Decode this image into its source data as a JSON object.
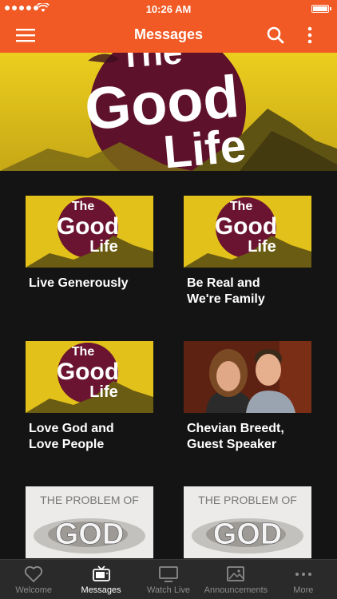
{
  "status_bar": {
    "time": "10:26 AM"
  },
  "header": {
    "title": "Messages"
  },
  "hero": {
    "title_words": [
      "The",
      "Good",
      "Life"
    ]
  },
  "cards": [
    {
      "label": "Live Generously",
      "thumb": "good-life"
    },
    {
      "label": "Be Real and\nWe're Family",
      "thumb": "good-life"
    },
    {
      "label": "Love God and\nLove People",
      "thumb": "good-life"
    },
    {
      "label": "Chevian Breedt,\nGuest Speaker",
      "thumb": "photo"
    },
    {
      "label": "",
      "thumb": "problem-of-god"
    },
    {
      "label": "",
      "thumb": "problem-of-god"
    }
  ],
  "thumb_text": {
    "good_life_words": [
      "The",
      "Good",
      "Life"
    ],
    "problem_of": "THE PROBLEM OF",
    "god": "GOD"
  },
  "tabbar": {
    "items": [
      {
        "label": "Welcome",
        "icon": "heart-icon"
      },
      {
        "label": "Messages",
        "icon": "tv-icon",
        "active": true
      },
      {
        "label": "Watch Live",
        "icon": "monitor-icon"
      },
      {
        "label": "Announcements",
        "icon": "image-icon"
      },
      {
        "label": "More",
        "icon": "more-dots-icon"
      }
    ]
  },
  "colors": {
    "accent": "#f15a24",
    "background": "#141414",
    "tabbar": "#2a2a2a",
    "yellow": "#e2c11a",
    "maroon": "#6b1431"
  }
}
